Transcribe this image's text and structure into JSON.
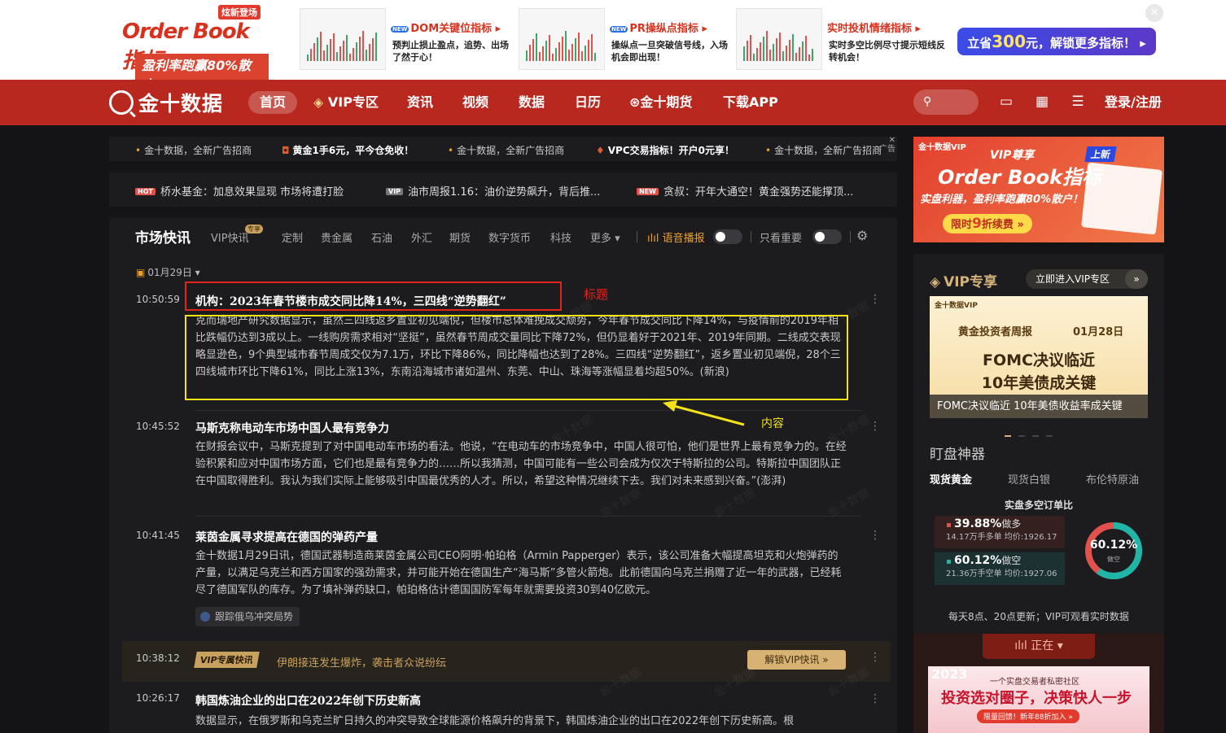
{
  "top_ad": {
    "logo_tag": "炫新登场",
    "logo_title": "Order Book指标",
    "logo_slogan": "盈利率跑赢80%散户",
    "cards": [
      {
        "title": "DOM关键位指标",
        "desc": "预判止损止盈点，追势、出场了然于心！"
      },
      {
        "title": "PR操纵点指标",
        "desc": "操纵点一旦突破信号线，入场机会即出现！"
      },
      {
        "title": "实时投机情绪指标",
        "desc": "实时多空比例尽寸提示短线反转机会！"
      }
    ],
    "cta_pre": "立省",
    "cta_num": "300",
    "cta_post": "元，解锁更多指标！ ▸",
    "close": "✕"
  },
  "nav": {
    "logo": "金十数据",
    "items": [
      "首页",
      "VIP专区",
      "资讯",
      "视频",
      "数据",
      "日历",
      "金十期货",
      "下载APP"
    ],
    "login": "登录/注册"
  },
  "marquee": {
    "items": [
      "金十数据，全新广告招商",
      "黄金1手6元，平今仓免收！",
      "金十数据，全新广告招商",
      "VPC交易指标！开户0元享！",
      "金十数据，全新广告招商"
    ],
    "close_label": "✕\n广告"
  },
  "hot": {
    "items": [
      {
        "badge": "HOT",
        "text": "桥水基金：加息效果显现 市场将遭打脸"
      },
      {
        "badge": "VIP",
        "text": "油市周报1.16：油价逆势飙升，背后推..."
      },
      {
        "badge": "NEW",
        "text": "贪叔：开年大通空！黄金强势还能撑顶..."
      }
    ]
  },
  "feed": {
    "title": "市场快讯",
    "tabs": [
      "VIP快讯",
      "定制",
      "贵金属",
      "石油",
      "外汇",
      "期货",
      "数字货币",
      "科技",
      "更多"
    ],
    "vip_badge": "专享",
    "voice": "语音播报",
    "important_only": "只看重要",
    "date": "01月29日",
    "news": [
      {
        "time": "10:50:59",
        "title": "机构：2023年春节楼市成交同比降14%，三四线“逆势翻红”",
        "body": "克而瑞地产研究数据显示，虽然三四线返乡置业初见端倪，但楼市总体难挽成交颓势，今年春节成交同比下降14%，与疫情前的2019年相比跌幅仍达到3成以上。一线购房需求相对“坚挺”，虽然春节周成交量同比下降72%，但仍显着好于2021年、2019年同期。二线成交表现略显逊色，9个典型城市春节周成交仅为7.1万，环比下降86%，同比降幅也达到了28%。三四线“逆势翻红”，返乡置业初见端倪，28个三四线城市环比下降61%，同比上涨13%，东南沿海城市诸如温州、东莞、中山、珠海等涨幅显着均超50%。(新浪)"
      },
      {
        "time": "10:45:52",
        "title": "马斯克称电动车市场中国人最有竞争力",
        "body": "在财报会议中，马斯克提到了对中国电动车市场的看法。他说，“在电动车的市场竞争中，中国人很可怕，他们是世界上最有竞争力的。在经验积累和应对中国市场方面，它们也是最有竞争力的……所以我猜测，中国可能有一些公司会成为仅次于特斯拉的公司。特斯拉中国团队正在中国取得胜利。我认为我们实际上能够吸引中国最优秀的人才。所以，希望这种情况继续下去。我们对未来感到兴奋。”(澎湃)"
      },
      {
        "time": "10:41:45",
        "title": "莱茵金属寻求提高在德国的弹药产量",
        "body": "金十数据1月29日讯，德国武器制造商莱茵金属公司CEO阿明·帕珀格（Armin Papperger）表示，该公司准备大幅提高坦克和火炮弹药的产量，以满足乌克兰和西方国家的强劲需求，并可能开始在德国生产“海马斯”多管火箭炮。此前德国向乌克兰捐赠了近一年的武器，已经耗尽了德国军队的库存。为了填补弹药缺口，帕珀格估计德国国防军每年就需要投资30到40亿欧元。",
        "tag": "跟踪俄乌冲突局势"
      },
      {
        "time": "10:26:17",
        "title": "韩国炼油企业的出口在2022年创下历史新高",
        "body": "数据显示，在俄罗斯和乌克兰旷日持久的冲突导致全球能源价格飙升的背景下，韩国炼油企业的出口在2022年创下历史新高。根"
      }
    ],
    "vip_flash": {
      "time": "10:38:12",
      "badge": "VIP专属快讯",
      "text": "伊朗接连发生爆炸，袭击者众说纷纭",
      "unlock": "解锁VIP快讯 »"
    }
  },
  "annotations": {
    "title_label": "标题",
    "content_label": "内容"
  },
  "side_ad": {
    "brand": "金十数据VIP",
    "vip": "VIP尊享",
    "new": "上新",
    "title": "Order Book指标",
    "slogan": "实盘利器，盈利率跑赢80%散户！",
    "discount_pre": "限时",
    "discount_num": "9",
    "discount_post": "折续费 »"
  },
  "vip_panel": {
    "title": "VIP专享",
    "enter": "立即进入VIP专区",
    "weekly_brand": "金十数据VIP",
    "weekly_name": "黄金投资者周报",
    "weekly_date": "01月28日",
    "weekly_h1": "FOMC决议临近",
    "weekly_h2": "10年美债成关键",
    "weekly_caption": "FOMC决议临近 10年美债收益率成关键"
  },
  "stare": {
    "title": "盯盘神器",
    "tabs": [
      "现货黄金",
      "现货白银",
      "布伦特原油"
    ],
    "order_title": "实盘多空订单比",
    "long_pct": "39.88%",
    "long_label": "做多",
    "long_detail": "14.17万手多单 均价:1926.17",
    "short_pct": "60.12%",
    "short_label": "做空",
    "short_detail": "21.36万手空单 均价:1927.06",
    "donut_value": "60.12%",
    "donut_label": "做空",
    "short_share": 0.6012,
    "footer": "每天8点、20点更新；VIP可观看实时数据"
  },
  "live": {
    "tab": "正在 ▾",
    "ad_year": "2023",
    "ad_line1": "一个实盘交易者私密社区",
    "ad_line2": "投资选对圈子，决策快人一步",
    "ad_line3": "限量回馈！新年88折加入 »"
  },
  "colors": {
    "brand_red": "#b8281e",
    "gold": "#d4b27a",
    "long_red": "#e2514b",
    "short_teal": "#1fb6a8"
  }
}
